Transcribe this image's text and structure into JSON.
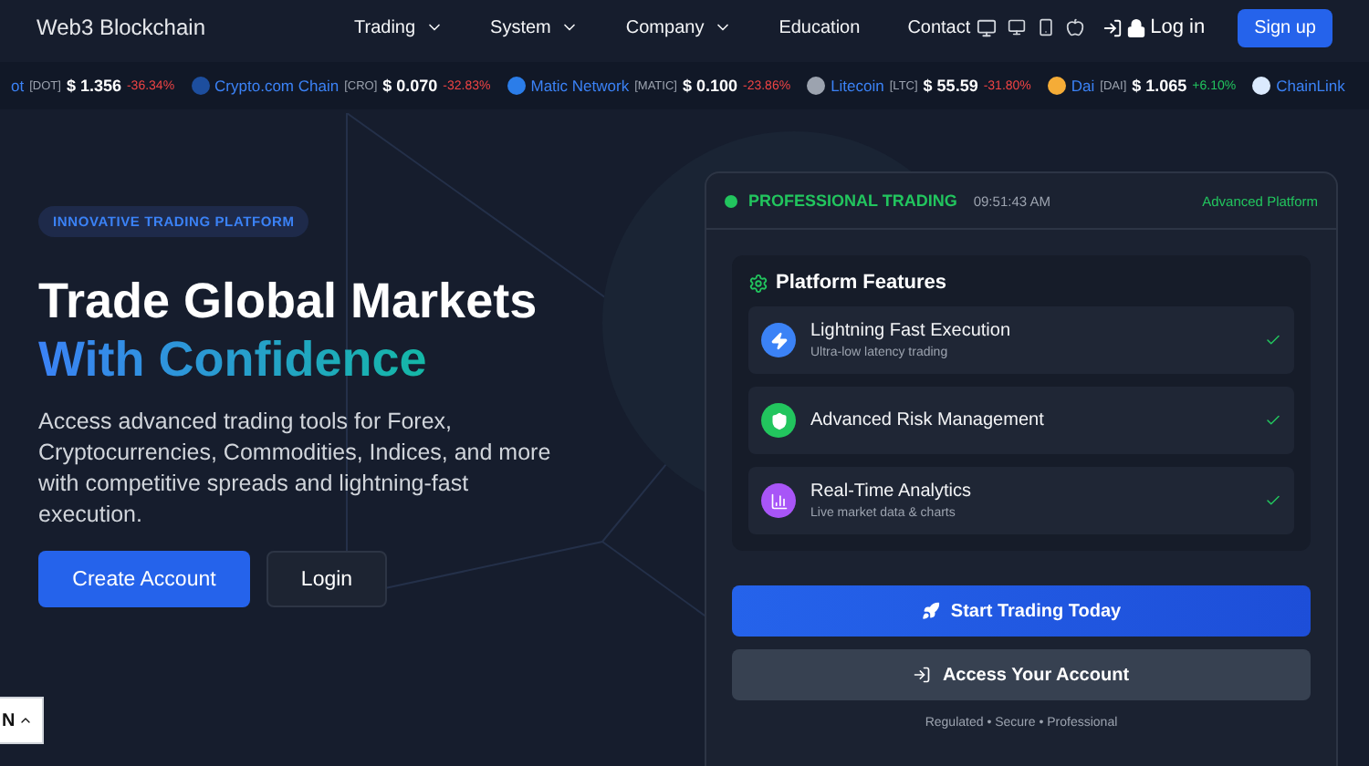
{
  "brand": "Web3 Blockchain",
  "nav": [
    {
      "label": "Trading",
      "dropdown": true
    },
    {
      "label": "System",
      "dropdown": true
    },
    {
      "label": "Company",
      "dropdown": true
    },
    {
      "label": "Education",
      "dropdown": false
    },
    {
      "label": "Contact",
      "dropdown": false
    }
  ],
  "login": "Log in",
  "signup": "Sign up",
  "ticker": [
    {
      "name": "ot",
      "symbol": "[DOT]",
      "price": "$ 1.356",
      "change": "-36.34%",
      "positive": false
    },
    {
      "name": "Crypto.com Chain",
      "symbol": "[CRO]",
      "price": "$ 0.070",
      "change": "-32.83%",
      "positive": false,
      "color": "#1d4e9e"
    },
    {
      "name": "Matic Network",
      "symbol": "[MATIC]",
      "price": "$ 0.100",
      "change": "-23.86%",
      "positive": false,
      "color": "#2b7de9"
    },
    {
      "name": "Litecoin",
      "symbol": "[LTC]",
      "price": "$ 55.59",
      "change": "-31.80%",
      "positive": false,
      "color": "#9ca3af"
    },
    {
      "name": "Dai",
      "symbol": "[DAI]",
      "price": "$ 1.065",
      "change": "+6.10%",
      "positive": true,
      "color": "#f5ac37"
    },
    {
      "name": "ChainLink",
      "color": "#dbeafe"
    }
  ],
  "hero": {
    "badge": "INNOVATIVE TRADING PLATFORM",
    "title_line1": "Trade Global Markets",
    "title_line2": "With Confidence",
    "description": "Access advanced trading tools for Forex, Cryptocurrencies, Commodities, Indices, and more with competitive spreads and lightning-fast execution.",
    "primary_button": "Create Account",
    "secondary_button": "Login"
  },
  "panel": {
    "status": "PROFESSIONAL TRADING",
    "time": "09:51:43 AM",
    "mode": "Advanced Platform",
    "features_title": "Platform Features",
    "features": [
      {
        "kind": "bolt",
        "title": "Lightning Fast Execution",
        "subtitle": "Ultra-low latency trading",
        "color": "#3b82f6",
        "checked": true
      },
      {
        "kind": "shield",
        "title": "Advanced Risk Management",
        "color": "#22c55e",
        "checked": true
      },
      {
        "kind": "chart",
        "title": "Real-Time Analytics",
        "subtitle": "Live market data & charts",
        "color": "#a855f7",
        "checked": true
      }
    ],
    "primary_button": "Start Trading Today",
    "secondary_button": "Access Your Account",
    "footer": "Regulated • Secure • Professional"
  },
  "language": "N"
}
